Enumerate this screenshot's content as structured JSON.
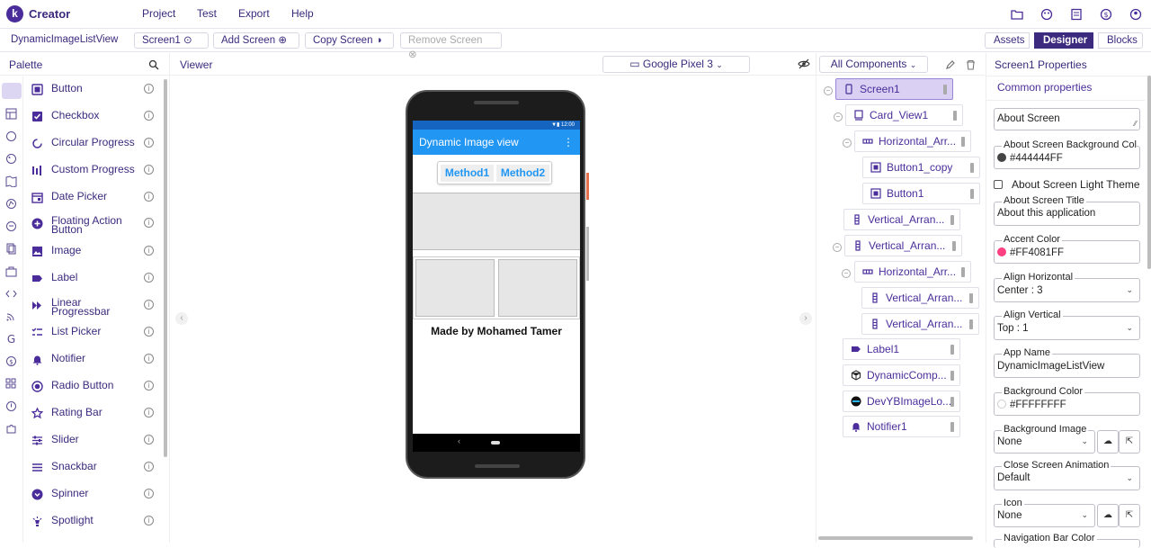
{
  "app": {
    "logo_letter": "k",
    "name": "Creator"
  },
  "menu": [
    "Project",
    "Test",
    "Export",
    "Help"
  ],
  "top_icons": [
    "folder-icon",
    "palette-icon",
    "book-icon",
    "dollar-icon",
    "account-icon"
  ],
  "toolbar": {
    "project_name": "DynamicImageListView",
    "screen_select": "Screen1",
    "add_screen": "Add Screen",
    "copy_screen": "Copy Screen",
    "remove_screen": "Remove Screen",
    "views": [
      "Assets",
      "Designer",
      "Blocks"
    ],
    "active_view": "Designer"
  },
  "palette": {
    "title": "Palette",
    "items": [
      "Button",
      "Checkbox",
      "Circular Progress",
      "Custom Progress",
      "Date Picker",
      "Floating Action Button",
      "Image",
      "Label",
      "Linear Progressbar",
      "List Picker",
      "Notifier",
      "Radio Button",
      "Rating Bar",
      "Slider",
      "Snackbar",
      "Spinner",
      "Spotlight"
    ]
  },
  "viewer": {
    "title": "Viewer",
    "device": "Google Pixel 3",
    "phone": {
      "time": "12:00",
      "app_title": "Dynamic Image view",
      "button1": "Method1",
      "button2": "Method2",
      "footer_label": "Made by Mohamed Tamer"
    }
  },
  "components": {
    "filter": "All Components",
    "tree": [
      "Screen1",
      "Card_View1",
      "Horizontal_Arr...",
      "Button1_copy",
      "Button1",
      "Vertical_Arran...",
      "Vertical_Arran...",
      "Horizontal_Arr...",
      "Vertical_Arran...",
      "Vertical_Arran...",
      "Label1",
      "DynamicComp...",
      "DevYBImageLo...",
      "Notifier1"
    ]
  },
  "properties": {
    "title": "Screen1 Properties",
    "section": "Common properties",
    "about_screen": "About Screen",
    "about_bg_color_label": "About Screen Background Colo",
    "about_bg_color": "#444444FF",
    "light_theme_label": "About Screen Light Theme",
    "about_title_label": "About Screen Title",
    "about_title": "About this application",
    "accent_label": "Accent Color",
    "accent": "#FF4081FF",
    "align_h_label": "Align Horizontal",
    "align_h": "Center : 3",
    "align_v_label": "Align Vertical",
    "align_v": "Top : 1",
    "app_name_label": "App Name",
    "app_name": "DynamicImageListView",
    "bg_color_label": "Background Color",
    "bg_color": "#FFFFFFFF",
    "bg_image_label": "Background Image",
    "bg_image": "None",
    "close_anim_label": "Close Screen Animation",
    "close_anim": "Default",
    "icon_label": "Icon",
    "icon": "None",
    "nav_bar_label": "Navigation Bar Color"
  },
  "colors": {
    "brand": "#3b2a7d",
    "accent": "#FF4081",
    "appbar": "#2196f3",
    "about_bg": "#444444"
  }
}
